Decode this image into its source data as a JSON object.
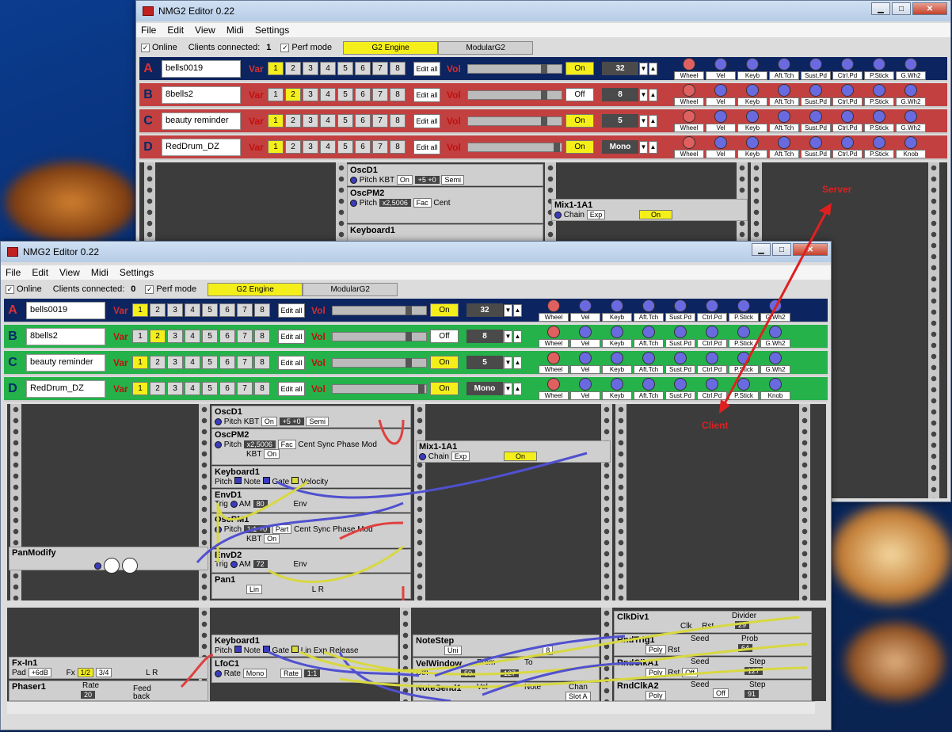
{
  "app": {
    "title": "NMG2 Editor 0.22"
  },
  "menu": [
    "File",
    "Edit",
    "View",
    "Midi",
    "Settings"
  ],
  "toolbar": {
    "online_label": "Online",
    "clients_label": "Clients connected:",
    "server_clients": "1",
    "client_clients": "0",
    "perf_label": "Perf mode",
    "tab_engine": "G2 Engine",
    "tab_modular": "ModularG2"
  },
  "slots": [
    {
      "letter": "A",
      "name": "bells0019",
      "var_selected": 1,
      "on_label": "On",
      "voices": "32"
    },
    {
      "letter": "B",
      "name": "8bells2",
      "var_selected": 2,
      "on_label": "Off",
      "voices": "8"
    },
    {
      "letter": "C",
      "name": "beauty reminder",
      "var_selected": 1,
      "on_label": "On",
      "voices": "5"
    },
    {
      "letter": "D",
      "name": "RedDrum_DZ",
      "var_selected": 1,
      "on_label": "On",
      "voices": "Mono"
    }
  ],
  "slot_labels": {
    "var": "Var",
    "edit_all": "Edit all",
    "vol": "Vol"
  },
  "vars": [
    "1",
    "2",
    "3",
    "4",
    "5",
    "6",
    "7",
    "8"
  ],
  "knob_labels_abc": [
    "Wheel",
    "Vel",
    "Keyb",
    "Aft.Tch",
    "Sust.Pd",
    "Ctrl.Pd",
    "P.Stick",
    "G.Wh2"
  ],
  "knob_labels_d": [
    "Wheel",
    "Vel",
    "Keyb",
    "Aft.Tch",
    "Sust.Pd",
    "Ctrl.Pd",
    "P.Stick",
    "Knob"
  ],
  "modules": {
    "oscd1": {
      "title": "OscD1",
      "pitch": "Pitch",
      "kbt": "KBT",
      "kbt_val": "On",
      "val": "+5 +0",
      "semi": "Semi"
    },
    "oscpm2": {
      "title": "OscPM2",
      "pitch": "Pitch",
      "fac": "Fac",
      "cent": "Cent",
      "val": "x2,5006",
      "kbt": "KBT",
      "kbt_val": "On",
      "sync": "Sync",
      "phase": "Phase",
      "mod": "Mod"
    },
    "keyboard1": {
      "title": "Keyboard1",
      "pitch": "Pitch",
      "note": "Note",
      "gate": "Gate",
      "velocity": "Velocity",
      "lin": "Lin",
      "exp": "Exp",
      "release": "Release"
    },
    "mix": {
      "title": "Mix1-1A1",
      "chain": "Chain",
      "exp": "Exp",
      "on": "On"
    },
    "envd1": {
      "title": "EnvD1",
      "trig": "Trig",
      "am": "AM",
      "val": "80",
      "env": "Env"
    },
    "oscpm1": {
      "title": "OscPM1",
      "pitch": "Pitch",
      "val": "1:1 +0",
      "part": "Part",
      "cent": "Cent",
      "kbt": "KBT",
      "kbt_val": "On",
      "sync": "Sync",
      "phase": "Phase",
      "mod": "Mod"
    },
    "envd2": {
      "title": "EnvD2",
      "trig": "Trig",
      "am": "AM",
      "val": "72",
      "env": "Env"
    },
    "pan": {
      "title": "Pan1",
      "lin": "Lin",
      "l": "L",
      "r": "R"
    },
    "panmodify": {
      "title": "PanModify"
    },
    "fxin": {
      "title": "Fx-In1",
      "pad": "Pad",
      "pad_val": "+6dB",
      "fx": "Fx",
      "fx_val": "1/2",
      "fx_val2": "3/4",
      "l": "L",
      "r": "R"
    },
    "phaser": {
      "title": "Phaser1",
      "rate": "Rate",
      "rate_val": "20",
      "feed": "Feed",
      "back": "back"
    },
    "keyboard1b": {
      "title": "Keyboard1",
      "pitch": "Pitch",
      "note": "Note",
      "gate": "Gate",
      "velocity": "Velocity",
      "lin": "Lin",
      "exp": "Exp",
      "release": "Release"
    },
    "lfoc1": {
      "title": "LfoC1",
      "rate": "Rate",
      "mono": "Mono",
      "rate2": "Rate",
      "val": "1:1"
    },
    "notestep": {
      "title": "NoteStep",
      "uni": "Uni",
      "val": "8"
    },
    "velwindow": {
      "title": "VelWindow",
      "from": "From",
      "to": "To",
      "ctrl": "Ctrl",
      "from_val": "50",
      "to_val": "127"
    },
    "notesend1": {
      "title": "NoteSend1",
      "vel": "Vel",
      "note": "Note",
      "chan": "Chan",
      "slot": "Slot A"
    },
    "clkdiv1": {
      "title": "ClkDiv1",
      "clk": "Clk",
      "rst": "Rst",
      "divider": "Divider",
      "div_val": "29"
    },
    "rndtrig1": {
      "title": "RndTrig1",
      "seed": "Seed",
      "prob": "Prob",
      "prob_val": "64",
      "poly": "Poly",
      "rst": "Rst"
    },
    "rndclka1": {
      "title": "RndClkA1",
      "seed": "Seed",
      "step": "Step",
      "step_val": "127",
      "poly": "Poly",
      "rst": "Rst",
      "off": "Off"
    },
    "rndclka2": {
      "title": "RndClkA2",
      "seed": "Seed",
      "step": "Step",
      "step_val": "91",
      "poly": "Poly",
      "off": "Off"
    }
  },
  "annotations": {
    "server": "Server",
    "client": "Client"
  },
  "colors": {
    "slot_a": "#0c2460",
    "slot_server": "#c24040",
    "slot_client": "#25b24a",
    "selected_var": "#f4ef1a",
    "cable_blue": "#5050d0",
    "cable_yellow": "#d8d840",
    "cable_red": "#e04040",
    "annotation": "#e02020"
  }
}
